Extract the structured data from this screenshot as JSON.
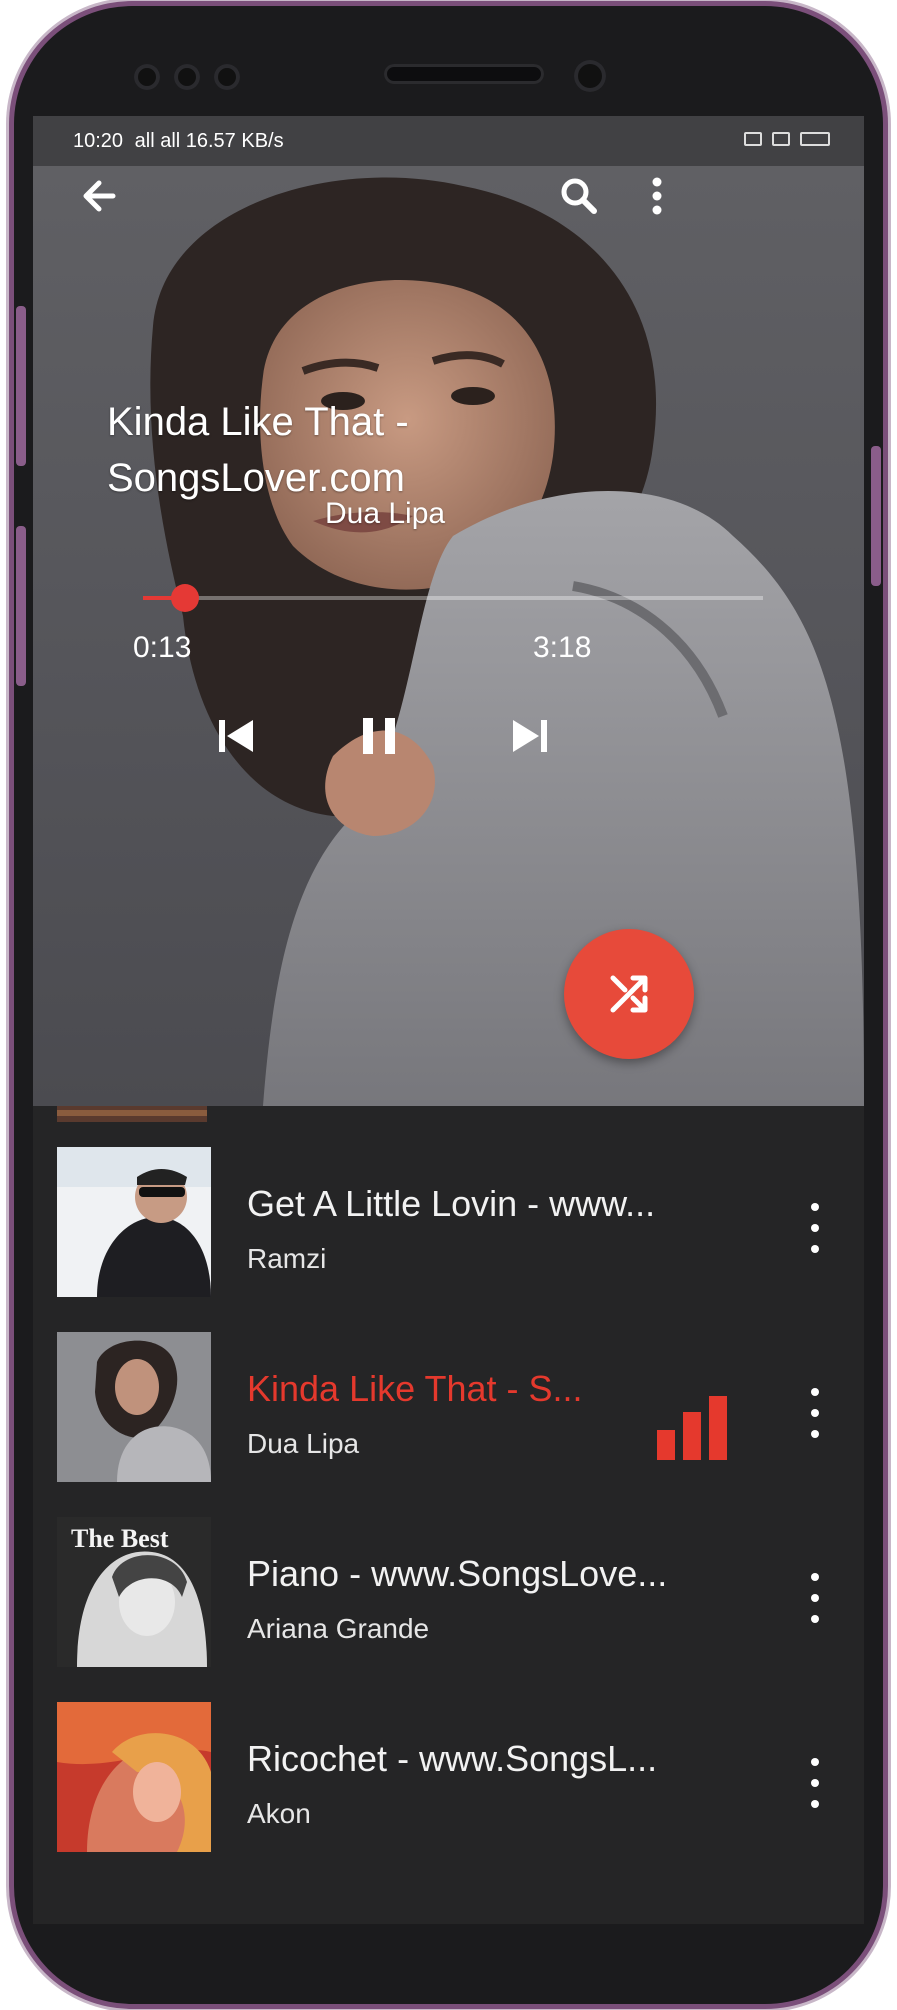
{
  "status_bar": {
    "time": "10:20",
    "signal_text": "all all 16.57 KB/s"
  },
  "toolbar": {
    "back_icon": "arrow-left-icon",
    "search_icon": "search-icon",
    "menu_icon": "more-vert-icon"
  },
  "now_playing": {
    "title_line1": "Kinda Like That -",
    "title_line2": "SongsLover.com",
    "artist": "Dua Lipa",
    "elapsed": "0:13",
    "duration": "3:18",
    "progress": 0.067
  },
  "controls": {
    "previous_icon": "skip-previous-icon",
    "pause_icon": "pause-icon",
    "next_icon": "skip-next-icon",
    "shuffle_icon": "shuffle-icon"
  },
  "colors": {
    "accent": "#e5392d",
    "list_background": "#252526",
    "text": "#f2f2f2"
  },
  "playlist": [
    {
      "title": "Get A Little Lovin - www...",
      "artist": "Ramzi",
      "playing": false
    },
    {
      "title": "Kinda Like That - S...",
      "artist": "Dua Lipa",
      "playing": true
    },
    {
      "title": "Piano - www.SongsLove...",
      "artist": "Ariana Grande",
      "playing": false
    },
    {
      "title": "Ricochet - www.SongsL...",
      "artist": "Akon",
      "playing": false
    }
  ],
  "album_art_text": {
    "item3": "The Best"
  }
}
